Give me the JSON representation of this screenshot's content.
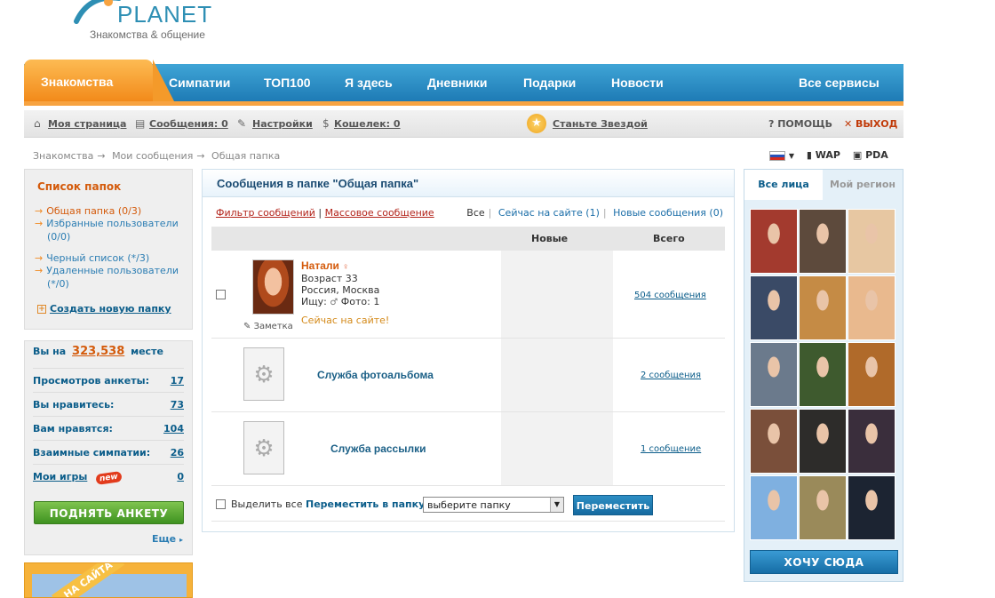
{
  "brand": {
    "name": "PLANET",
    "tagline": "Знакомства & общение"
  },
  "nav": {
    "active": "Знакомства",
    "items": [
      "Симпатии",
      "ТОП100",
      "Я здесь",
      "Дневники",
      "Подарки",
      "Новости"
    ],
    "all_services": "Все сервисы"
  },
  "userbar": {
    "my_page": "Моя страница",
    "messages": "Сообщения: 0",
    "settings": "Настройки",
    "wallet": "Кошелек: 0",
    "star": "Станьте Звездой",
    "help": "ПОМОЩЬ",
    "exit": "ВЫХОД"
  },
  "breadcrumb": [
    "Знакомства",
    "Мои сообщения",
    "Общая папка"
  ],
  "langs": {
    "wap": "WAP",
    "pda": "PDA"
  },
  "folders": {
    "title": "Список папок",
    "items": [
      "Общая папка (0/3)",
      "Избранные пользователи (0/0)",
      "Черный список (*/3)",
      "Удаленные пользователи (*/0)"
    ],
    "create": "Создать новую папку"
  },
  "stats": {
    "place_prefix": "Вы на",
    "place_value": "323,538",
    "place_suffix": "месте",
    "rows": [
      {
        "label": "Просмотров анкеты:",
        "value": "17"
      },
      {
        "label": "Вы нравитесь:",
        "value": "73"
      },
      {
        "label": "Вам нравятся:",
        "value": "104"
      },
      {
        "label": "Взаимные симпатии:",
        "value": "26"
      },
      {
        "label": "Мои игры",
        "value": "0",
        "badge": "new"
      }
    ],
    "lift_button": "ПОДНЯТЬ АНКЕТУ",
    "more": "Еще"
  },
  "promo": {
    "ribbon": "НА САЙТА"
  },
  "main": {
    "title": "Сообщения в папке \"Общая папка\"",
    "filter_link": "Фильтр сообщений",
    "mass_link": "Массовое сообщение",
    "tabs": [
      "Все",
      "Сейчас на сайте (1)",
      "Новые сообщения (0)"
    ],
    "col_new": "Новые",
    "col_total": "Всего",
    "conversations": [
      {
        "name": "Натали",
        "age": "Возраст 33",
        "location": "Россия, Москва",
        "seeking": "Ищу:",
        "photos": "Фото: 1",
        "online": "Сейчас на сайте!",
        "note": "Заметка",
        "total": "504 сообщения"
      }
    ],
    "services": [
      {
        "name": "Служба фотоальбома",
        "total": "2 сообщения"
      },
      {
        "name": "Служба рассылки",
        "total": "1 сообщение"
      }
    ],
    "select_all": "Выделить все",
    "move_label": "Переместить в папку:",
    "move_select": "выберите папку",
    "move_button": "Переместить"
  },
  "right": {
    "tab_all": "Все лица",
    "tab_region": "Мой регион",
    "faces": [
      "#a33a2e",
      "#5d4a3c",
      "#e7c7a2",
      "#3a4a66",
      "#c58b45",
      "#e9b98e",
      "#6b7a8c",
      "#3e5a2e",
      "#b06a2a",
      "#7a4f3a",
      "#2d2c2a",
      "#3a2e3c",
      "#7fb0e0",
      "#9a8a5a",
      "#1c2432"
    ],
    "want_button": "ХОЧУ СЮДА"
  },
  "colors": {
    "nav_blue": "#1e7bb5",
    "accent_orange": "#f28a1a",
    "link": "#0b5d8a"
  }
}
